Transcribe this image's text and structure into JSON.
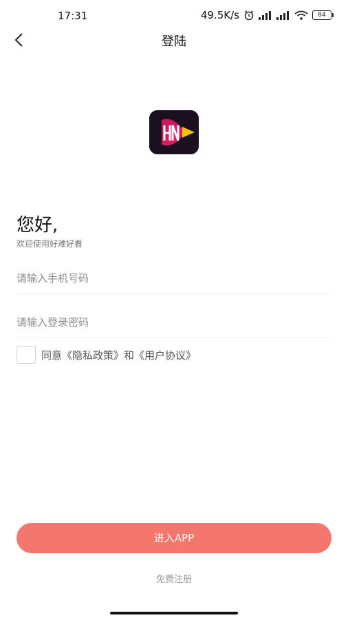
{
  "status_bar": {
    "time": "17:31",
    "speed": "49.5K/s",
    "battery": "84"
  },
  "nav": {
    "title": "登陆"
  },
  "greeting": {
    "title": "您好,",
    "subtitle": "欢迎使用好难好看"
  },
  "form": {
    "phone_placeholder": "请输入手机号码",
    "password_placeholder": "请输入登录密码",
    "agreement": "同意《隐私政策》和《用户协议》"
  },
  "actions": {
    "enter_label": "进入APP",
    "register_label": "免费注册"
  },
  "colors": {
    "primary_button": "#f5766c"
  }
}
